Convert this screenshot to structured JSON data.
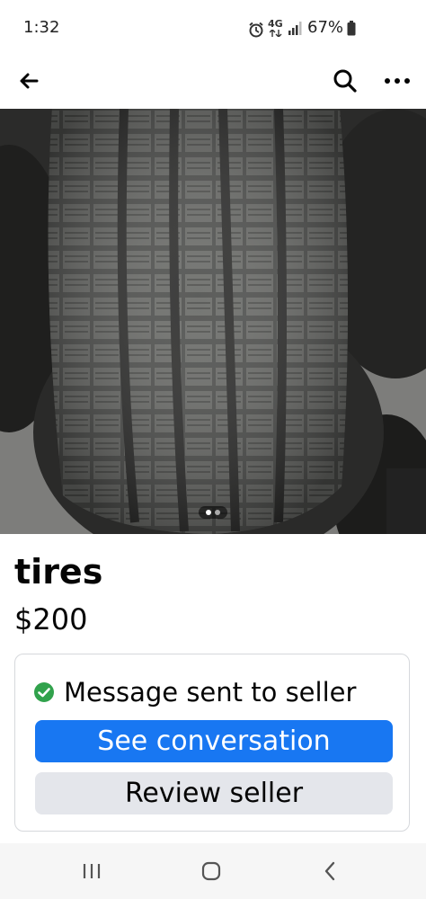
{
  "status": {
    "time": "1:32",
    "network": "4G",
    "battery": "67%"
  },
  "app_bar": {
    "back_icon": "arrow-left-icon",
    "search_icon": "search-icon",
    "more_icon": "more-horizontal-icon"
  },
  "listing": {
    "title": "tires",
    "price": "$200",
    "photo_count": 2,
    "active_photo": 1
  },
  "seller_card": {
    "message": "Message sent to seller",
    "primary_button": "See conversation",
    "secondary_button": "Review seller"
  },
  "colors": {
    "accent": "#1877f2",
    "success": "#31a24c",
    "secondary_button_bg": "#e4e6eb"
  }
}
